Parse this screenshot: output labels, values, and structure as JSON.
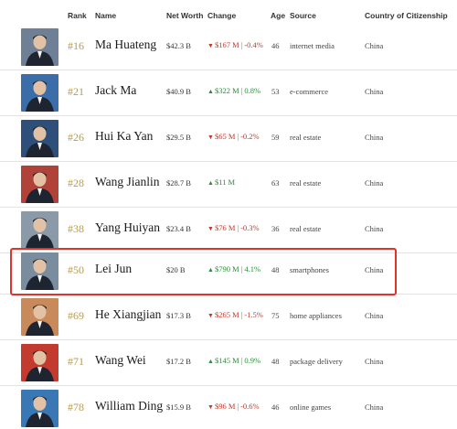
{
  "header": {
    "rank": "Rank",
    "name": "Name",
    "net_worth": "Net Worth",
    "change": "Change",
    "age": "Age",
    "source": "Source",
    "country": "Country of Citizenship"
  },
  "rows": [
    {
      "rank": "#16",
      "name": "Ma Huateng",
      "net_worth": "$42.3 B",
      "change_dir": "down",
      "change_amount": "$167 M",
      "change_pct": "-0.4%",
      "age": "46",
      "source": "internet media",
      "country": "China"
    },
    {
      "rank": "#21",
      "name": "Jack Ma",
      "net_worth": "$40.9 B",
      "change_dir": "up",
      "change_amount": "$322 M",
      "change_pct": "0.8%",
      "age": "53",
      "source": "e-commerce",
      "country": "China"
    },
    {
      "rank": "#26",
      "name": "Hui Ka Yan",
      "net_worth": "$29.5 B",
      "change_dir": "down",
      "change_amount": "$65 M",
      "change_pct": "-0.2%",
      "age": "59",
      "source": "real estate",
      "country": "China"
    },
    {
      "rank": "#28",
      "name": "Wang Jianlin",
      "net_worth": "$28.7 B",
      "change_dir": "up",
      "change_amount": "$11 M",
      "change_pct": "",
      "age": "63",
      "source": "real estate",
      "country": "China"
    },
    {
      "rank": "#38",
      "name": "Yang Huiyan",
      "net_worth": "$23.4 B",
      "change_dir": "down",
      "change_amount": "$76 M",
      "change_pct": "-0.3%",
      "age": "36",
      "source": "real estate",
      "country": "China"
    },
    {
      "rank": "#50",
      "name": "Lei Jun",
      "net_worth": "$20 B",
      "change_dir": "up",
      "change_amount": "$790 M",
      "change_pct": "4.1%",
      "age": "48",
      "source": "smartphones",
      "country": "China"
    },
    {
      "rank": "#69",
      "name": "He Xiangjian",
      "net_worth": "$17.3 B",
      "change_dir": "down",
      "change_amount": "$265 M",
      "change_pct": "-1.5%",
      "age": "75",
      "source": "home appliances",
      "country": "China"
    },
    {
      "rank": "#71",
      "name": "Wang Wei",
      "net_worth": "$17.2 B",
      "change_dir": "up",
      "change_amount": "$145 M",
      "change_pct": "0.9%",
      "age": "48",
      "source": "package delivery",
      "country": "China"
    },
    {
      "rank": "#78",
      "name": "William Ding",
      "net_worth": "$15.9 B",
      "change_dir": "down",
      "change_amount": "$96 M",
      "change_pct": "-0.6%",
      "age": "46",
      "source": "online games",
      "country": "China"
    }
  ],
  "highlighted_row": 5,
  "colors": {
    "rank_gold": "#b89a4a",
    "change_up": "#2e8b3d",
    "change_down": "#c0392b",
    "highlight_border": "#e0342b",
    "photo_backgrounds": [
      "#6f7f95",
      "#3b6ea8",
      "#2d4f7a",
      "#b0423a",
      "#8a9aa8",
      "#7a8d9e",
      "#c88a5a",
      "#c23b2e",
      "#3a78b5"
    ]
  }
}
